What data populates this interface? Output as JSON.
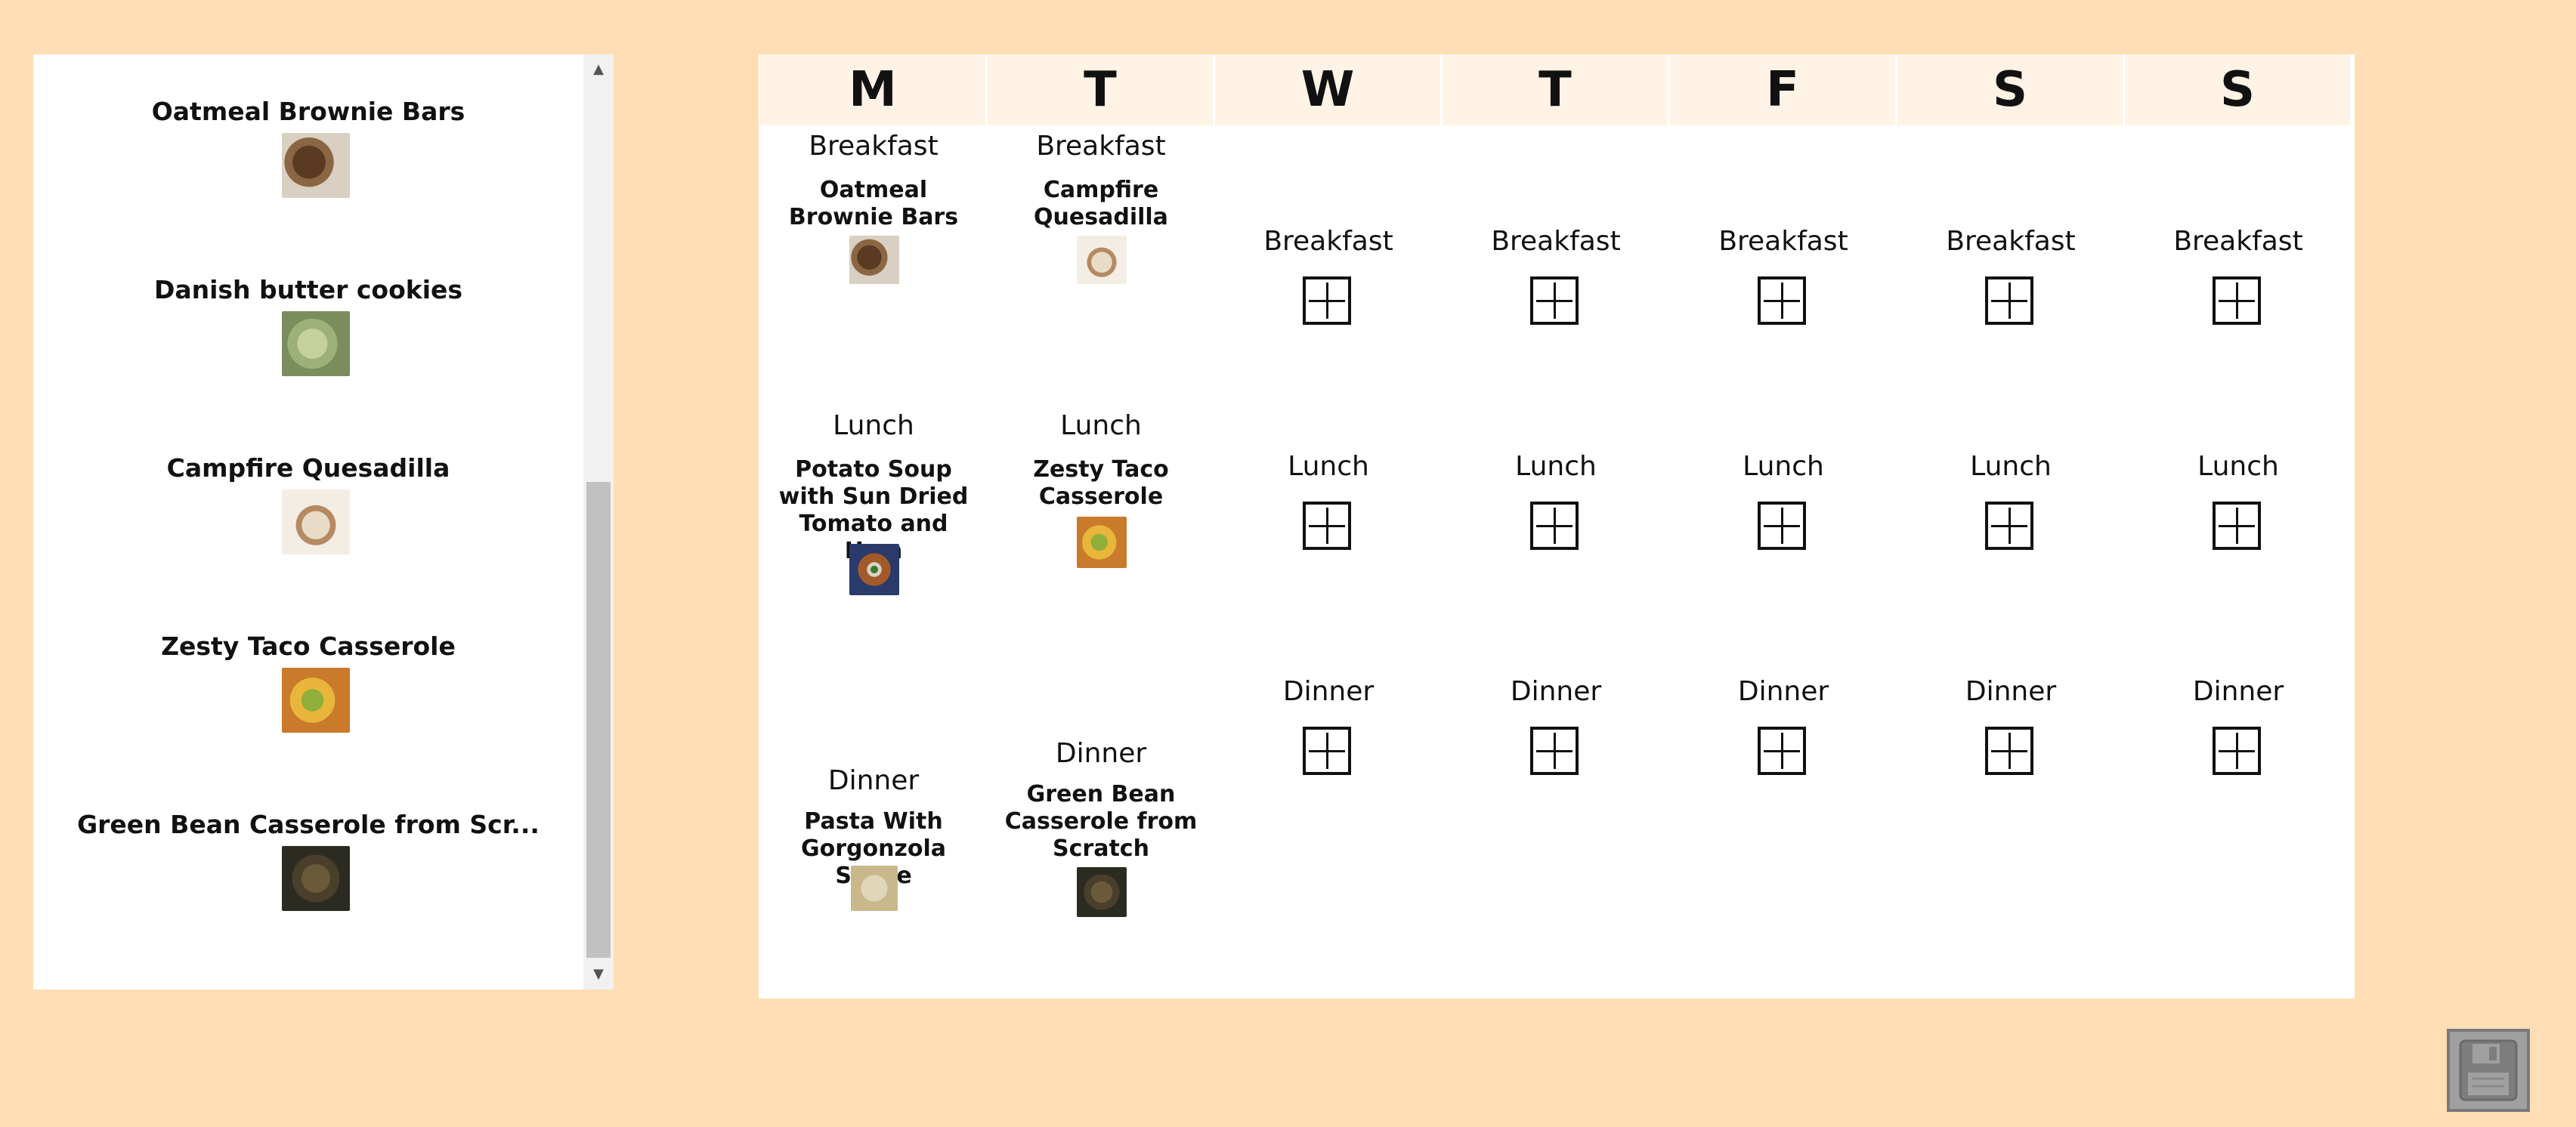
{
  "recipe_list": {
    "items": [
      {
        "title": "Oatmeal Brownie Bars",
        "thumb": "brownie-photo"
      },
      {
        "title": "Danish butter cookies",
        "thumb": "cookie-photo"
      },
      {
        "title": "Campfire Quesadilla",
        "thumb": "quesadilla-photo"
      },
      {
        "title": "Zesty Taco Casserole",
        "thumb": "taco-casserole-photo"
      },
      {
        "title": "Green Bean Casserole from Scr...",
        "thumb": "green-bean-casserole-photo"
      }
    ]
  },
  "planner": {
    "days": [
      "M",
      "T",
      "W",
      "T",
      "F",
      "S",
      "S"
    ],
    "meals": {
      "breakfast": "Breakfast",
      "lunch": "Lunch",
      "dinner": "Dinner"
    },
    "monday": {
      "breakfast": "Oatmeal Brownie Bars",
      "lunch": "Potato Soup with Sun Dried Tomato and Ham",
      "dinner": "Pasta With Gorgonzola Sauce"
    },
    "tuesday": {
      "breakfast": "Campfire Quesadilla",
      "lunch": "Zesty Taco Casserole",
      "dinner": "Green Bean Casserole from Scratch"
    },
    "empty_slot_icon": "plus-box-icon"
  },
  "save_icon": "floppy-disk-icon",
  "colors": {
    "background": "#FFDEB5",
    "day_header": "#FFF3E6",
    "panel": "#FFFFFF",
    "save_button": "#A0A0A0"
  }
}
